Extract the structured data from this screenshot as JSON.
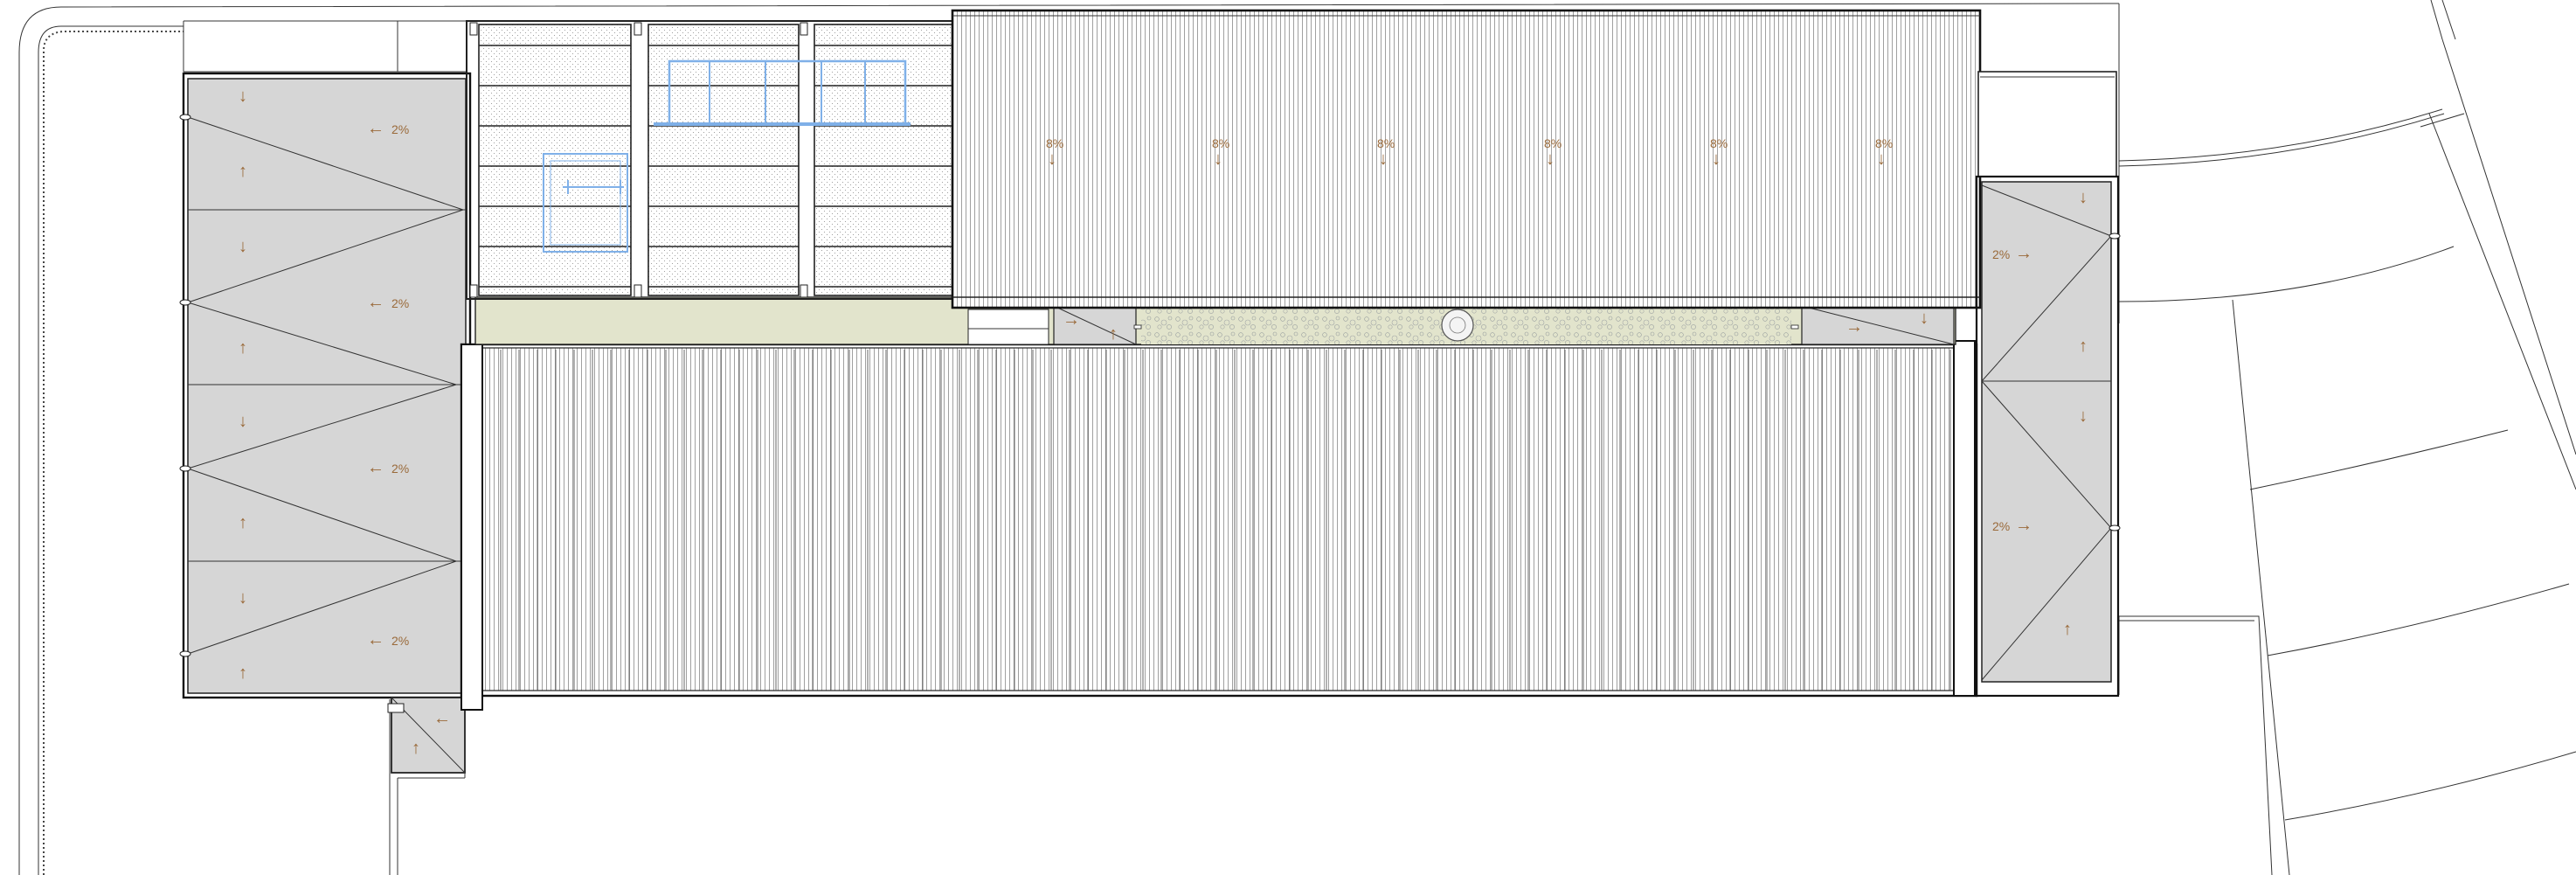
{
  "drawing": {
    "type": "roof plan",
    "colors": {
      "roof_fill": "#d6d6d6",
      "courtyard_fill": "#e2e4cc",
      "annotation": "#9a6a3a",
      "blue_element": "#7fb0e8",
      "line": "#222222"
    },
    "slope_labels": {
      "left_1": "2%",
      "left_2": "2%",
      "left_3": "2%",
      "left_4": "2%",
      "right_1": "2%",
      "right_2": "2%",
      "metal_1": "8%",
      "metal_2": "8%",
      "metal_3": "8%",
      "metal_4": "8%",
      "metal_5": "8%",
      "metal_6": "8%"
    },
    "arrow_glyphs": {
      "up": "↑",
      "down": "↓",
      "left": "←",
      "right": "→"
    }
  }
}
